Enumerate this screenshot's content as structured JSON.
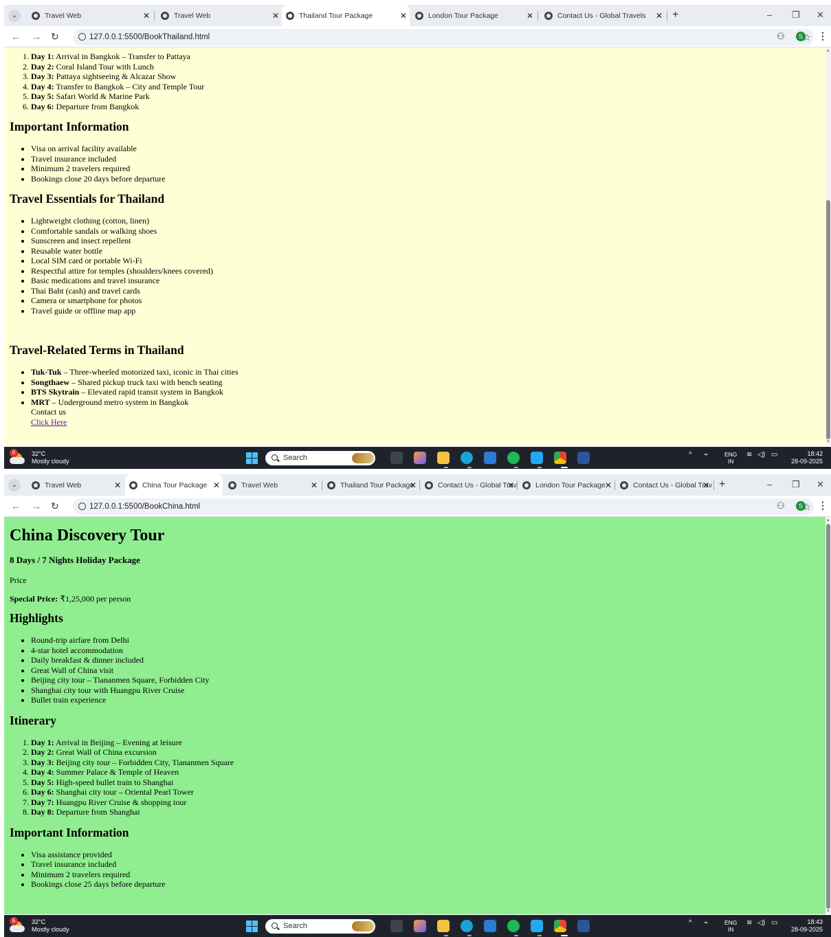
{
  "top": {
    "tabs": [
      {
        "label": "Travel Web"
      },
      {
        "label": "Travel Web"
      },
      {
        "label": "Thailand Tour Package"
      },
      {
        "label": "London Tour Package"
      },
      {
        "label": "Contact Us - Global Travels"
      }
    ],
    "url": "127.0.0.1:5500/BookThailand.html",
    "itinerary": [
      {
        "day": "Day 1:",
        "text": " Arrival in Bangkok – Transfer to Pattaya"
      },
      {
        "day": "Day 2:",
        "text": " Coral Island Tour with Lunch"
      },
      {
        "day": "Day 3:",
        "text": " Pattaya sightseeing & Alcazar Show"
      },
      {
        "day": "Day 4:",
        "text": " Transfer to Bangkok – City and Temple Tour"
      },
      {
        "day": "Day 5:",
        "text": " Safari World & Marine Park"
      },
      {
        "day": "Day 6:",
        "text": " Departure from Bangkok"
      }
    ],
    "info_heading": "Important Information",
    "info": [
      "Visa on arrival facility available",
      "Travel insurance included",
      "Minimum 2 travelers required",
      "Bookings close 20 days before departure"
    ],
    "essentials_heading": "Travel Essentials for Thailand",
    "essentials": [
      "Lightweight clothing (cotton, linen)",
      "Comfortable sandals or walking shoes",
      "Sunscreen and insect repellent",
      "Reusable water bottle",
      "Local SIM card or portable Wi-Fi",
      "Respectful attire for temples (shoulders/knees covered)",
      "Basic medications and travel insurance",
      "Thai Baht (cash) and travel cards",
      "Camera or smartphone for photos",
      "Travel guide or offline map app"
    ],
    "terms_heading": "Travel-Related Terms in Thailand",
    "terms": [
      {
        "term": "Tuk-Tuk",
        "desc": " – Three-wheeled motorized taxi, iconic in Thai cities"
      },
      {
        "term": "Songthaew",
        "desc": " – Shared pickup truck taxi with bench seating"
      },
      {
        "term": "BTS Skytrain",
        "desc": " – Elevated rapid transit system in Bangkok"
      },
      {
        "term": "MRT",
        "desc": " – Underground metro system in Bangkok"
      }
    ],
    "contact_text": "Contact us",
    "contact_link": "Click Here",
    "time": "18:42",
    "date": "28-09-2025",
    "bg_color": "#ffffd5"
  },
  "bottom": {
    "tabs": [
      {
        "label": "Travel Web"
      },
      {
        "label": "China Tour Package"
      },
      {
        "label": "Travel Web"
      },
      {
        "label": "Thailand Tour Package"
      },
      {
        "label": "Contact Us - Global Travels"
      },
      {
        "label": "London Tour Package"
      },
      {
        "label": "Contact Us - Global Travels"
      }
    ],
    "url": "127.0.0.1:5500/BookChina.html",
    "title": "China Discovery Tour",
    "subtitle": "8 Days / 7 Nights Holiday Package",
    "price_label": "Price",
    "special_label": "Special Price:",
    "special_value": " ₹1,25,000 per person",
    "highlights_heading": "Highlights",
    "highlights": [
      "Round-trip airfare from Delhi",
      "4-star hotel accommodation",
      "Daily breakfast & dinner included",
      "Great Wall of China visit",
      "Beijing city tour – Tiananmen Square, Forbidden City",
      "Shanghai city tour with Huangpu River Cruise",
      "Bullet train experience"
    ],
    "itinerary_heading": "Itinerary",
    "itinerary": [
      {
        "day": "Day 1:",
        "text": " Arrival in Beijing – Evening at leisure"
      },
      {
        "day": "Day 2:",
        "text": " Great Wall of China excursion"
      },
      {
        "day": "Day 3:",
        "text": " Beijing city tour – Forbidden City, Tiananmen Square"
      },
      {
        "day": "Day 4:",
        "text": " Summer Palace & Temple of Heaven"
      },
      {
        "day": "Day 5:",
        "text": " High-speed bullet train to Shanghai"
      },
      {
        "day": "Day 6:",
        "text": " Shanghai city tour – Oriental Pearl Tower"
      },
      {
        "day": "Day 7:",
        "text": " Huangpu River Cruise & shopping tour"
      },
      {
        "day": "Day 8:",
        "text": " Departure from Shanghai"
      }
    ],
    "info_heading": "Important Information",
    "info": [
      "Visa assistance provided",
      "Travel insurance included",
      "Minimum 2 travelers required",
      "Bookings close 25 days before departure"
    ],
    "time": "18:43",
    "date": "28-09-2025",
    "bg_color": "#90ee90"
  },
  "taskbar": {
    "temp": "32°C",
    "condition": "Mostly cloudy",
    "badge": "6",
    "search": "Search",
    "lang": "ENG",
    "region": "IN"
  },
  "profile_initial": "S",
  "icons": {
    "tab_list": "chevron-down-icon",
    "back": "back-arrow-icon",
    "forward": "forward-arrow-icon",
    "reload": "reload-icon",
    "bookmark": "star-icon",
    "menu": "more-vert-icon"
  }
}
